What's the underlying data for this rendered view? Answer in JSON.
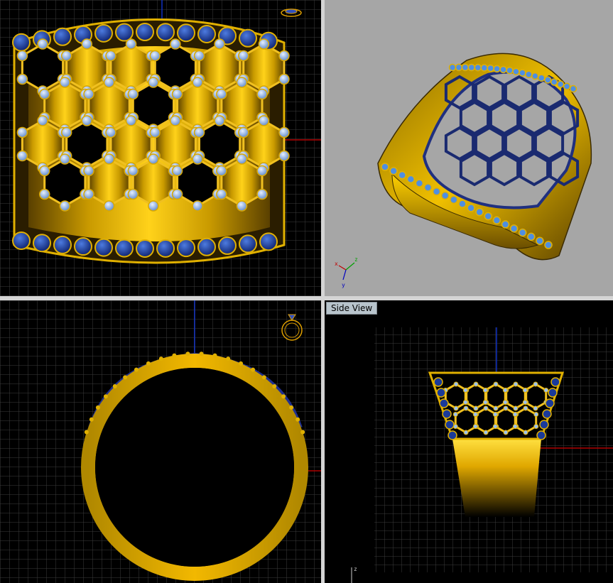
{
  "viewports": [
    {
      "id": "top",
      "label": ""
    },
    {
      "id": "perspective",
      "label": ""
    },
    {
      "id": "front",
      "label": ""
    },
    {
      "id": "side",
      "label": "Side View"
    }
  ],
  "axes": {
    "x": "x",
    "y": "y",
    "z": "z"
  },
  "colors": {
    "grid": "#3a3a3a",
    "grid_major": "#5a5a5a",
    "axis_red": "#b00000",
    "axis_blue": "#1030c0",
    "gold": "#e0b000",
    "gold_dark": "#6b4e00",
    "sapphire": "#1a3a9a",
    "light_stone": "#8fb3e6",
    "persp_bg": "#a6a6a6"
  }
}
